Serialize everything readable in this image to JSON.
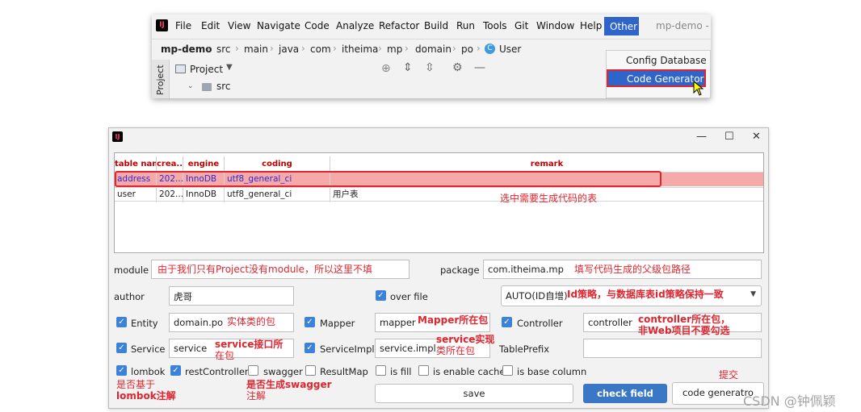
{
  "ide": {
    "logo": "IJ",
    "menu": [
      "File",
      "Edit",
      "View",
      "Navigate",
      "Code",
      "Analyze",
      "Refactor",
      "Build",
      "Run",
      "Tools",
      "Git",
      "Window",
      "Help"
    ],
    "menu_other": "Other",
    "window_title": "mp-demo - Ac",
    "breadcrumb": [
      "mp-demo",
      "src",
      "main",
      "java",
      "com",
      "itheima",
      "mp",
      "domain",
      "po",
      "User"
    ],
    "side_tab": "Project",
    "project_label": "Project",
    "tree_item": "src",
    "dropdown": {
      "config_database": "Config Database",
      "code_generator": "Code Generator"
    }
  },
  "dialog": {
    "logo": "IJ",
    "controls": {
      "minimize": "—",
      "maximize": "☐",
      "close": "✕"
    },
    "table": {
      "headers": [
        "table name",
        "crea...",
        "engine",
        "coding",
        "remark"
      ],
      "rows": [
        [
          "address",
          "202...",
          "InnoDB",
          "utf8_general_ci",
          ""
        ],
        [
          "user",
          "202...",
          "InnoDB",
          "utf8_general_ci",
          "用户表"
        ]
      ]
    },
    "annotations": {
      "select_table": "选中需要生成代码的表",
      "module_note": "由于我们只有Project没有module，所以这里不填",
      "package_note": "填写代码生成的父级包路径",
      "id_note": "Id策略，与数据库表id策略保持一致",
      "entity_note": "实体类的包",
      "mapper_note": "Mapper所在包",
      "controller_note_1": "controller所在包，",
      "controller_note_2": "非Web项目不要勾选",
      "service_note_1": "service接口所",
      "service_note_2": "在包",
      "serviceimpl_note_1": "service实现",
      "serviceimpl_note_2": "类所在包",
      "lombok_note_1": "是否基于",
      "lombok_note_2": "lombok注解",
      "swagger_note_1": "是否生成swagger",
      "swagger_note_2": "注解",
      "submit_note": "提交"
    },
    "form": {
      "module_label": "module",
      "module_value": "",
      "package_label": "package",
      "package_value": "com.itheima.mp",
      "author_label": "author",
      "author_value": "虎哥",
      "overfile_label": "over file",
      "id_strategy": "AUTO(ID自增)",
      "entity_label": "Entity",
      "entity_value": "domain.po",
      "mapper_label": "Mapper",
      "mapper_value": "mapper",
      "controller_label": "Controller",
      "controller_value": "controller",
      "service_label": "Service",
      "service_value": "service",
      "serviceimpl_label": "ServiceImpl",
      "serviceimpl_value": "service.impl",
      "tableprefix_label": "TablePrefix",
      "tableprefix_value": "",
      "lombok_label": "lombok",
      "restcontroller_label": "restController",
      "swagger_label": "swagger",
      "resultmap_label": "ResultMap",
      "isfill_label": "is fill",
      "isenablecache_label": "is enable cache",
      "isbasecolumn_label": "is base column"
    },
    "buttons": {
      "save": "save",
      "check_field": "check field",
      "code_generator": "code generatro"
    }
  },
  "watermark": "CSDN @钟佩颖"
}
